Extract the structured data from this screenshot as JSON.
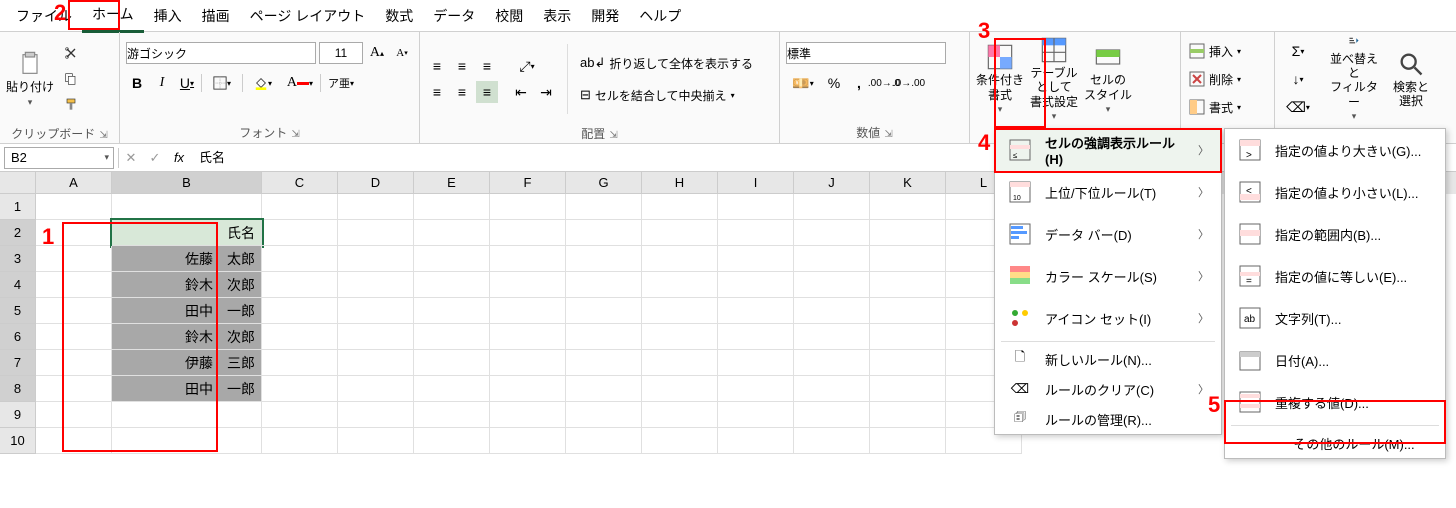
{
  "tabs": {
    "file": "ファイル",
    "home": "ホーム",
    "insert": "挿入",
    "draw": "描画",
    "layout": "ページ レイアウト",
    "formulas": "数式",
    "data": "データ",
    "review": "校閲",
    "view": "表示",
    "developer": "開発",
    "help": "ヘルプ"
  },
  "ribbon": {
    "clipboard": {
      "paste": "貼り付け",
      "group": "クリップボード"
    },
    "font": {
      "name": "游ゴシック",
      "size": "11",
      "group": "フォント"
    },
    "alignment": {
      "wrap": "折り返して全体を表示する",
      "merge": "セルを結合して中央揃え",
      "group": "配置"
    },
    "number": {
      "format": "標準",
      "group": "数値"
    },
    "styles": {
      "conditional": "条件付き\n書式",
      "table": "テーブルとして\n書式設定",
      "cell": "セルの\nスタイル"
    },
    "cells": {
      "insert": "挿入",
      "delete": "削除",
      "format": "書式"
    },
    "editing": {
      "sort": "並べ替えと\nフィルター",
      "find": "検索と\n選択"
    }
  },
  "namebox": "B2",
  "formula": "氏名",
  "columns": [
    "A",
    "B",
    "C",
    "D",
    "E",
    "F",
    "G",
    "H",
    "I",
    "J",
    "K",
    "L"
  ],
  "rows": [
    "1",
    "2",
    "3",
    "4",
    "5",
    "6",
    "7",
    "8",
    "9",
    "10"
  ],
  "cells": {
    "B2": "氏名",
    "B3": "佐藤　太郎",
    "B4": "鈴木　次郎",
    "B5": "田中　一郎",
    "B6": "鈴木　次郎",
    "B7": "伊藤　三郎",
    "B8": "田中　一郎"
  },
  "menu1": {
    "highlight": "セルの強調表示ルール(H)",
    "topbottom": "上位/下位ルール(T)",
    "databars": "データ バー(D)",
    "colorscales": "カラー スケール(S)",
    "iconsets": "アイコン セット(I)",
    "newrule": "新しいルール(N)...",
    "clear": "ルールのクリア(C)",
    "manage": "ルールの管理(R)..."
  },
  "menu2": {
    "greater": "指定の値より大きい(G)...",
    "less": "指定の値より小さい(L)...",
    "between": "指定の範囲内(B)...",
    "equal": "指定の値に等しい(E)...",
    "text": "文字列(T)...",
    "date": "日付(A)...",
    "duplicate": "重複する値(D)...",
    "more": "その他のルール(M)..."
  },
  "annotations": {
    "n1": "1",
    "n2": "2",
    "n3": "3",
    "n4": "4",
    "n5": "5"
  }
}
